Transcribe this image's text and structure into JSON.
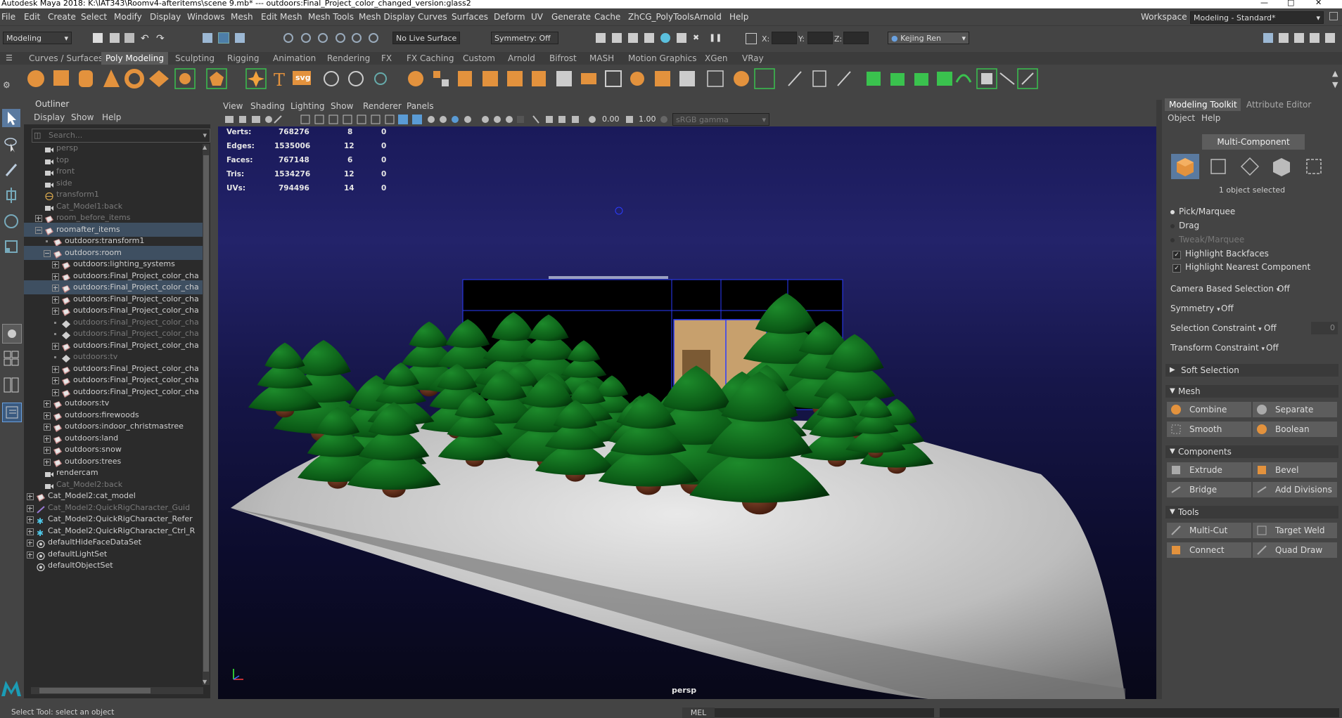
{
  "app": {
    "title": "Autodesk Maya 2018: K:\\IAT343\\Roomv4-afteritems\\scene 9.mb*   ---   outdoors:Final_Project_color_changed_version:glass2",
    "workspace_label": "Workspace :",
    "workspace_value": "Modeling - Standard*"
  },
  "menus": [
    "File",
    "Edit",
    "Create",
    "Select",
    "Modify",
    "Display",
    "Windows",
    "Mesh",
    "Edit Mesh",
    "Mesh Tools",
    "Mesh Display",
    "Curves",
    "Surfaces",
    "Deform",
    "UV",
    "Generate",
    "Cache",
    "ZhCG_PolyTools",
    "Arnold",
    "Help"
  ],
  "statusline": {
    "menuset": "Modeling",
    "live_surface": "No Live Surface",
    "symmetry": "Symmetry: Off",
    "x_label": "X:",
    "y_label": "Y:",
    "z_label": "Z:",
    "user": "Kejing Ren"
  },
  "shelf_tabs": [
    "Curves / Surfaces",
    "Poly Modeling",
    "Sculpting",
    "Rigging",
    "Animation",
    "Rendering",
    "FX",
    "FX Caching",
    "Custom",
    "Arnold",
    "Bifrost",
    "MASH",
    "Motion Graphics",
    "XGen",
    "VRay"
  ],
  "shelf_active": "Poly Modeling",
  "shelf_svg_label": "svg",
  "outliner": {
    "title": "Outliner",
    "menu": [
      "Display",
      "Show",
      "Help"
    ],
    "search_placeholder": "Search...",
    "rows": [
      {
        "label": "persp",
        "dim": true
      },
      {
        "label": "top",
        "dim": true
      },
      {
        "label": "front",
        "dim": true
      },
      {
        "label": "side",
        "dim": true
      },
      {
        "label": "transform1",
        "dim": true
      },
      {
        "label": "Cat_Model1:back",
        "dim": true
      },
      {
        "label": "room_before_items",
        "dim": true
      },
      {
        "label": "roomafter_items",
        "dim": false
      },
      {
        "label": "outdoors:transform1",
        "dim": false
      },
      {
        "label": "outdoors:room",
        "dim": false
      },
      {
        "label": "outdoors:lighting_systems",
        "dim": false
      },
      {
        "label": "outdoors:Final_Project_color_cha",
        "dim": false
      },
      {
        "label": "outdoors:Final_Project_color_cha",
        "dim": false
      },
      {
        "label": "outdoors:Final_Project_color_cha",
        "dim": false
      },
      {
        "label": "outdoors:Final_Project_color_cha",
        "dim": false
      },
      {
        "label": "outdoors:Final_Project_color_cha",
        "dim": true
      },
      {
        "label": "outdoors:Final_Project_color_cha",
        "dim": true
      },
      {
        "label": "outdoors:Final_Project_color_cha",
        "dim": false
      },
      {
        "label": "outdoors:tv",
        "dim": true
      },
      {
        "label": "outdoors:Final_Project_color_cha",
        "dim": false
      },
      {
        "label": "outdoors:Final_Project_color_cha",
        "dim": false
      },
      {
        "label": "outdoors:Final_Project_color_cha",
        "dim": false
      },
      {
        "label": "outdoors:tv",
        "dim": false
      },
      {
        "label": "outdoors:firewoods",
        "dim": false
      },
      {
        "label": "outdoors:indoor_christmastree",
        "dim": false
      },
      {
        "label": "outdoors:land",
        "dim": false
      },
      {
        "label": "outdoors:snow",
        "dim": false
      },
      {
        "label": "outdoors:trees",
        "dim": false
      },
      {
        "label": "rendercam",
        "dim": false
      },
      {
        "label": "Cat_Model2:back",
        "dim": true
      },
      {
        "label": "Cat_Model2:cat_model",
        "dim": false
      },
      {
        "label": "Cat_Model2:QuickRigCharacter_Guid",
        "dim": true
      },
      {
        "label": "Cat_Model2:QuickRigCharacter_Refer",
        "dim": false
      },
      {
        "label": "Cat_Model2:QuickRigCharacter_Ctrl_R",
        "dim": false
      },
      {
        "label": "defaultHideFaceDataSet",
        "dim": false
      },
      {
        "label": "defaultLightSet",
        "dim": false
      },
      {
        "label": "defaultObjectSet",
        "dim": false
      }
    ]
  },
  "viewport": {
    "menu": [
      "View",
      "Shading",
      "Lighting",
      "Show",
      "Renderer",
      "Panels"
    ],
    "exposure": "0.00",
    "gamma": "1.00",
    "color_space": "sRGB gamma",
    "camera_label": "persp",
    "hud": [
      {
        "label": "Verts:",
        "total": "768276",
        "selected": "8",
        "x": "0"
      },
      {
        "label": "Edges:",
        "total": "1535006",
        "selected": "12",
        "x": "0"
      },
      {
        "label": "Faces:",
        "total": "767148",
        "selected": "6",
        "x": "0"
      },
      {
        "label": "Tris:",
        "total": "1534276",
        "selected": "12",
        "x": "0"
      },
      {
        "label": "UVs:",
        "total": "794496",
        "selected": "14",
        "x": "0"
      }
    ]
  },
  "toolkit": {
    "tab_active": "Modeling Toolkit",
    "tab_other": "Attribute Editor",
    "menu": [
      "Object",
      "Help"
    ],
    "mode": "Multi-Component",
    "selected_text": "1 object selected",
    "pick_marquee": "Pick/Marquee",
    "drag": "Drag",
    "tweak_marquee": "Tweak/Marquee",
    "highlight_backfaces": "Highlight Backfaces",
    "highlight_nearest": "Highlight Nearest Component",
    "camera_based": "Camera Based Selection",
    "symmetry": "Symmetry",
    "selection_constraint": "Selection Constraint",
    "transform_constraint": "Transform Constraint",
    "off": "Off",
    "zero": "0",
    "soft_selection": "Soft Selection",
    "sections": {
      "mesh": "Mesh",
      "components": "Components",
      "tools": "Tools"
    },
    "mesh_buttons": [
      "Combine",
      "Separate",
      "Smooth",
      "Boolean"
    ],
    "component_buttons": [
      "Extrude",
      "Bevel",
      "Bridge",
      "Add Divisions"
    ],
    "tool_buttons": [
      "Multi-Cut",
      "Target Weld",
      "Connect",
      "Quad Draw"
    ]
  },
  "bottom": {
    "help_text": "Select Tool: select an object",
    "mel_label": "MEL"
  }
}
